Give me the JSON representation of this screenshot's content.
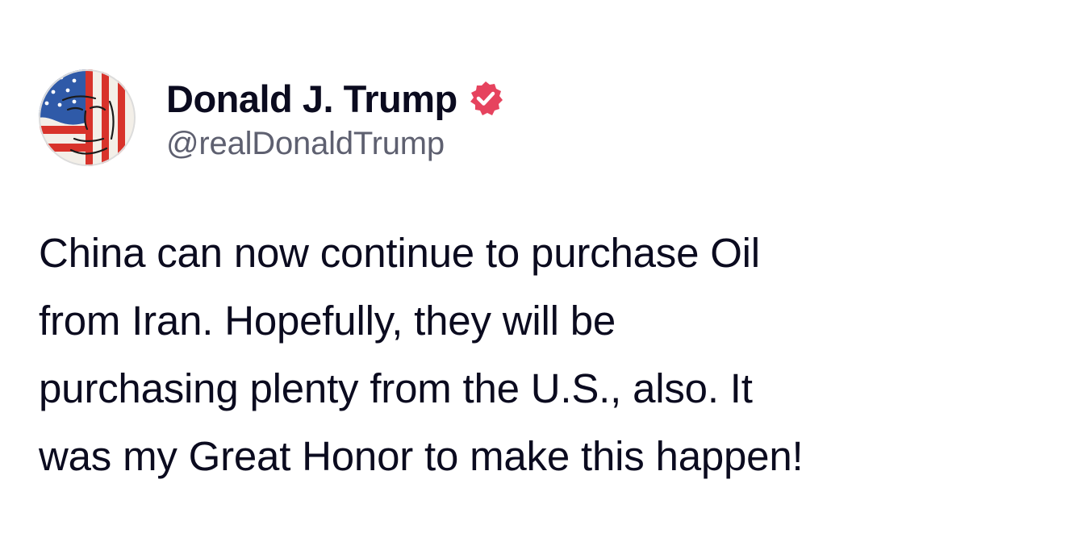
{
  "author": {
    "display_name": "Donald J. Trump",
    "handle": "@realDonaldTrump",
    "verified": true,
    "verified_badge_icon": "verified-badge-icon",
    "avatar_icon": "flag-portrait-avatar"
  },
  "post": {
    "text": "China can now continue to purchase Oil\nfrom Iran. Hopefully, they will be\npurchasing plenty from the U.S., also. It\nwas my Great Honor to make this happen!"
  },
  "colors": {
    "verified_badge": "#e6435e",
    "name_text": "#0b0b1f",
    "handle_text": "#5e6070",
    "background": "#ffffff"
  }
}
